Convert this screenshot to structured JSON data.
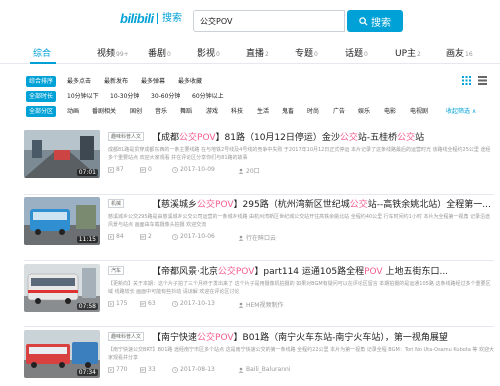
{
  "header": {
    "logo": "bilibili",
    "logo_sub": "搜索",
    "search_value": "公交POV",
    "search_button": "搜索"
  },
  "tabs": [
    {
      "label": "综合",
      "count": ""
    },
    {
      "label": "视频",
      "count": "99+"
    },
    {
      "label": "番剧",
      "count": "0"
    },
    {
      "label": "影视",
      "count": "0"
    },
    {
      "label": "直播",
      "count": "2"
    },
    {
      "label": "专题",
      "count": "0"
    },
    {
      "label": "话题",
      "count": "0"
    },
    {
      "label": "UP主",
      "count": "2"
    },
    {
      "label": "画友",
      "count": "16"
    }
  ],
  "filters": {
    "sort": [
      "综合排序",
      "最多点击",
      "最新发布",
      "最多弹幕",
      "最多收藏"
    ],
    "duration": [
      "全部时长",
      "10分钟以下",
      "10-30分钟",
      "30-60分钟",
      "60分钟以上"
    ],
    "zone": [
      "全部分区",
      "动画",
      "番剧相关",
      "国创",
      "音乐",
      "舞蹈",
      "游戏",
      "科技",
      "生活",
      "鬼畜",
      "时尚",
      "广告",
      "娱乐",
      "电影",
      "电视剧"
    ],
    "zone_more": "收起筛选 ∧"
  },
  "results": [
    {
      "category": "趣味科普人文",
      "title_pre": "【成都",
      "title_kw": "公交POV",
      "title_mid": "】81路（10月12日停运）金沙",
      "title_kw2": "公交",
      "title_mid2": "站-五桂桥",
      "title_kw3": "公交",
      "title_post": "站",
      "desc": "成都81路是贯穿成都东西的一条主要线路 在与地铁2号线及4号线的竞争中失败 于2017年10月12日正式停运 本片记录了这条线路最后的运营时光 该路线全程约25公里 途经多个重要站点 欢迎大家观看 并在评论区分享你们与81路的故事",
      "duration": "07:01",
      "views": "87",
      "danmaku": "0",
      "date": "2017-10-09",
      "up": "20口"
    },
    {
      "category": "机械",
      "title_pre": "【慈溪城乡",
      "title_kw": "公交POV",
      "title_mid": "】295路（杭州湾新区世纪城",
      "title_kw2": "公交",
      "title_mid2": "站--高铁余姚北站）全程第一",
      "title_kw3": "",
      "title_post": "...",
      "desc": "慈溪城乡公交295路是由慈溪城乡公交公司运营的一条城乡线路 由杭州湾新区世纪城公交站开往高铁余姚北站 全程约40公里 行车时间约1小时 本片为全程第一视角 记录沿途风景与站点 画面由车载摄像头拍摄 欢迎交流",
      "duration": "11:15",
      "views": "84",
      "danmaku": "2",
      "date": "2017-10-06",
      "up": "行在眸口云"
    },
    {
      "category": "汽车",
      "title_pre": "【帝都风景·北京",
      "title_kw": "公交POV",
      "title_mid": "】part114 运通105路全程",
      "title_kw2": "POV",
      "title_mid2": " 上地五街东口...",
      "title_kw3": "",
      "title_post": "",
      "desc": "【更新向】关于本期：这个片子拍了三个月终于发出来了 这个片子是用摄像机拍摄的 如果对BGM有疑问可以在评论区留言 本期拍摄的是运通105路 这条线路经过多个重要区域 线路较长 画面中可能有些抖动 请谅解 欢迎在评论区讨论",
      "duration": "07:58",
      "views": "175",
      "danmaku": "63",
      "date": "2017-10-13",
      "up": "HEM视频制作"
    },
    {
      "category": "趣味科普人文",
      "title_pre": "【南宁快速",
      "title_kw": "公交POV",
      "title_mid": "】B01路（南宁火车东站-南宁火车站），第一视角展望",
      "title_kw2": "",
      "title_mid2": "",
      "title_kw3": "",
      "title_post": "",
      "desc": "【南宁快速公交BRT】B01路 途经南宁市区多个站点 这是南宁快速公交的第一条线路 全程约22公里 本片为第一视角 记录全程 BGM：Tori No Uta-Osamu Kubota 等 欢迎大家观看并分享",
      "duration": "07:34",
      "views": "770",
      "danmaku": "33",
      "date": "2017-08-13",
      "up": "Baili_Baluranni"
    }
  ],
  "colors": {
    "accent": "#00a1d6",
    "keyword": "#f25d8e"
  }
}
